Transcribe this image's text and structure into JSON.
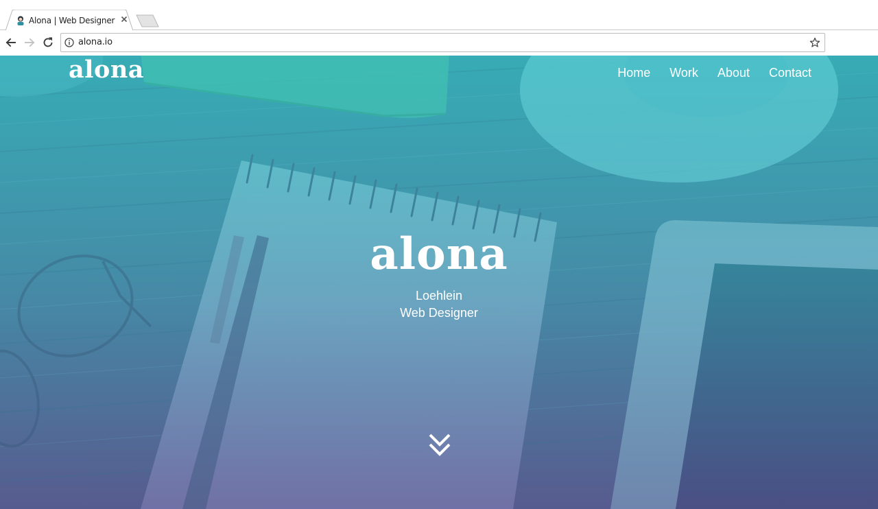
{
  "browser": {
    "tab_title": "Alona | Web Designer",
    "url": "alona.io",
    "icons": {
      "back": "back-arrow-icon",
      "forward": "forward-arrow-icon",
      "reload": "reload-icon",
      "info": "info-icon",
      "bookmark": "star-icon",
      "close_tab": "close-icon"
    }
  },
  "site": {
    "logo": "alona",
    "nav": [
      "Home",
      "Work",
      "About",
      "Contact"
    ],
    "hero": {
      "title": "alona",
      "name": "Loehlein",
      "role": "Web Designer"
    },
    "scroll_icon": "double-chevron-down-icon"
  },
  "colors": {
    "overlay_top": "#3ebac4",
    "overlay_bottom": "#605c96",
    "text": "#ffffff"
  }
}
